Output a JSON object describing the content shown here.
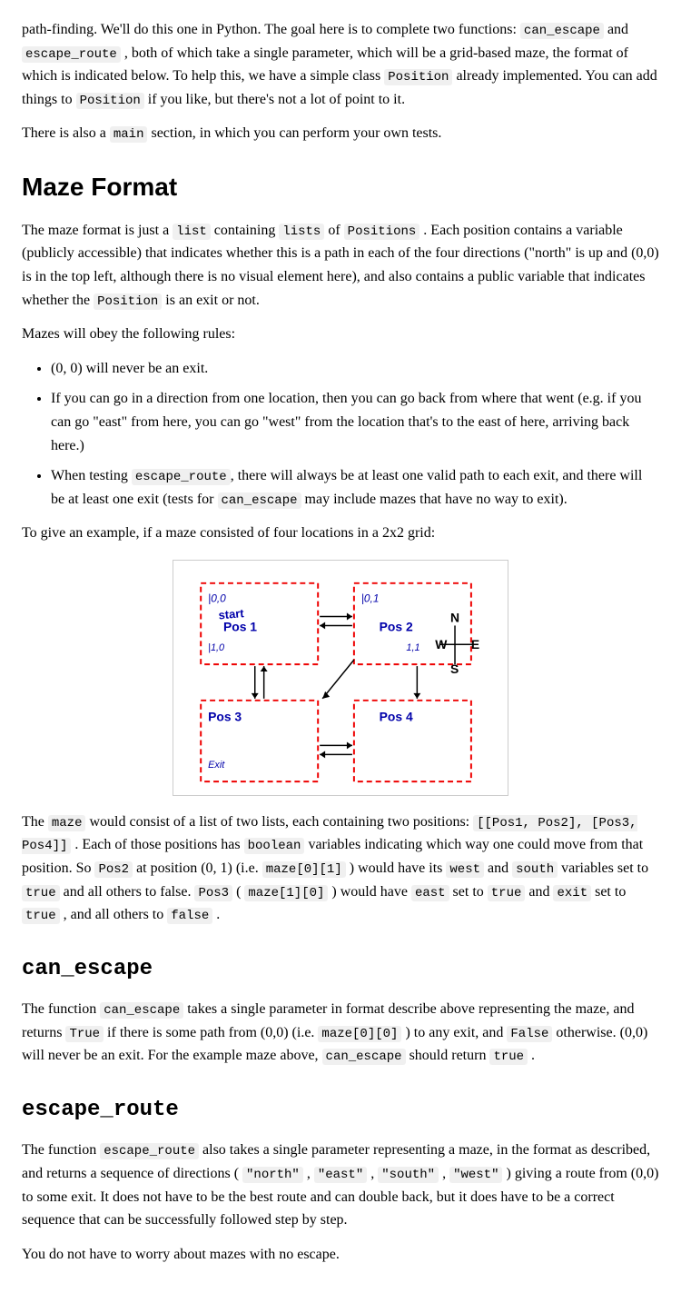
{
  "intro": {
    "para1": "path-finding. We'll do this one in Python. The goal here is to complete two functions:",
    "code_can_escape": "can_escape",
    "and": "and",
    "code_escape_route": "escape_route",
    "para1_cont": ", both of which take a single parameter, which will be a grid-based maze, the format of which is indicated below. To help this, we have a simple class",
    "code_position": "Position",
    "para1_cont2": "already implemented. You can add things to",
    "code_position2": "Position",
    "para1_cont3": "if you like, but there's not a lot of point to it.",
    "para2_pre": "There is also a",
    "code_main": "main",
    "para2_cont": "section, in which you can perform your own tests."
  },
  "maze_format": {
    "heading": "Maze Format",
    "para1_pre": "The maze format is just a",
    "code_list": "list",
    "para1_mid": "containing",
    "code_lists": "lists",
    "para1_mid2": "of",
    "code_positions": "Positions",
    "para1_cont": ". Each position contains a variable (publicly accessible) that indicates whether this is a path in each of the four directions (\"north\" is up and (0,0) is in the top left, although there is no visual element here), and also contains a public variable that indicates whether the",
    "code_position": "Position",
    "para1_end": "is an exit or not.",
    "para2": "Mazes will obey the following rules:",
    "rules": [
      "(0, 0) will never be an exit.",
      "If you can go in a direction from one location, then you can go back from where that went (e.g. if you can go \"east\" from here, you can go \"west\" from the location that's to the east of here, arriving back here.)",
      "When testing escape_route, there will always be at least one valid path to each exit, and there will be at least one exit (tests for can_escape may include mazes that have no way to exit)."
    ],
    "rule2_code": "escape_route",
    "rule2_code2": "can_escape",
    "para3": "To give an example, if a maze consisted of four locations in a 2x2 grid:",
    "para4_pre": "The",
    "code_maze": "maze",
    "para4_cont": "would consist of a list of two lists, each containing two positions:",
    "code_positions_list": "[[Pos1, Pos2], [Pos3, Pos4]]",
    "para4_end": ". Each of those positions has",
    "code_boolean": "boolean",
    "para4_end2": "variables indicating which way one could move from that position. So",
    "code_pos2": "Pos2",
    "para4_end3": "at position",
    "math_pos": "(0, 1)",
    "para4_end4": "(i.e.",
    "code_maze_01": "maze[0][1]",
    "para4_end5": ") would have its",
    "code_west": "west",
    "para4_and": "and",
    "code_south": "south",
    "para4_end6": "variables set to",
    "code_true": "true",
    "para4_end7": "and all others to false.",
    "code_pos3": "Pos3",
    "para4_end8": "(",
    "code_maze_10": "maze[1][0]",
    "para4_end9": ") would have",
    "code_east": "east",
    "para4_end10": "set to",
    "code_true2": "true",
    "para4_and2": "and",
    "code_exit": "exit",
    "para4_end11": "set to",
    "code_true3": "true",
    "para4_comma": ",",
    "para4_end12": "and all others to",
    "code_false": "false",
    "para4_period": "."
  },
  "can_escape": {
    "heading": "can_escape",
    "para1_pre": "The function",
    "code_can_escape": "can_escape",
    "para1_cont": "takes a single parameter in format describe above representing the maze, and returns",
    "code_true": "True",
    "para1_cont2": "if there is some path from (0,0) (i.e.",
    "code_maze_00": "maze[0][0]",
    "para1_cont3": ") to any exit, and",
    "code_false": "False",
    "para1_end": "otherwise. (0,0) will never be an exit. For the example maze above,",
    "code_can_escape2": "can_escape",
    "para1_end2": "should return",
    "code_true2": "true",
    "period": "."
  },
  "escape_route": {
    "heading": "escape_route",
    "para1_pre": "The function",
    "code_escape_route": "escape_route",
    "para1_cont": "also takes a single parameter representing a maze, in the format as described, and returns a sequence of directions (",
    "code_north": "\"north\"",
    "comma1": ",",
    "code_east": "\"east\"",
    "comma2": ",",
    "code_south": "\"south\"",
    "comma3": ",",
    "code_west": "\"west\"",
    "para1_end": ") giving a route from (0,0) to some exit. It does not have to be the best route and can double back, but it does have to be a correct sequence that can be successfully followed step by step.",
    "para2": "You do not have to worry about mazes with no escape."
  }
}
